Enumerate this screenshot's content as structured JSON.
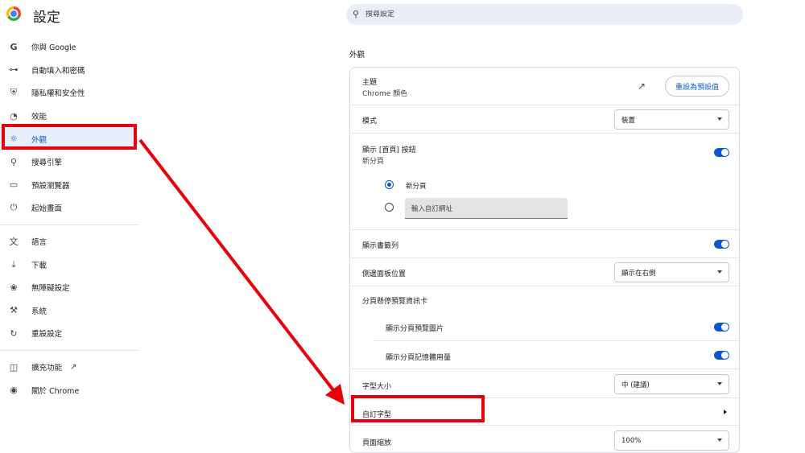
{
  "app": {
    "title": "設定"
  },
  "search": {
    "placeholder": "搜尋設定"
  },
  "sidebar": {
    "items": [
      {
        "label": "你與 Google",
        "icon": "google-icon"
      },
      {
        "label": "自動填入和密碼",
        "icon": "key-icon"
      },
      {
        "label": "隱私權和安全性",
        "icon": "shield-icon"
      },
      {
        "label": "效能",
        "icon": "speedometer-icon"
      },
      {
        "label": "外觀",
        "icon": "palette-icon",
        "active": true
      },
      {
        "label": "搜尋引擎",
        "icon": "search-icon"
      },
      {
        "label": "預設瀏覽器",
        "icon": "browser-window-icon"
      },
      {
        "label": "起始畫面",
        "icon": "power-icon"
      },
      {
        "label": "語言",
        "icon": "translate-icon"
      },
      {
        "label": "下載",
        "icon": "download-icon"
      },
      {
        "label": "無障礙設定",
        "icon": "accessibility-icon"
      },
      {
        "label": "系統",
        "icon": "wrench-icon"
      },
      {
        "label": "重設設定",
        "icon": "reset-icon"
      },
      {
        "label": "擴充功能",
        "icon": "puzzle-icon"
      },
      {
        "label": "關於 Chrome",
        "icon": "chrome-icon"
      }
    ]
  },
  "appearance": {
    "section_title": "外觀",
    "theme": {
      "label": "主題",
      "value": "Chrome 顏色",
      "reset_label": "重設為預設值"
    },
    "mode": {
      "label": "模式",
      "value": "裝置"
    },
    "home_button": {
      "label": "顯示 [首頁] 按鈕",
      "sub": "新分頁",
      "enabled": true
    },
    "radio_new_tab": {
      "label": "新分頁",
      "selected": true
    },
    "radio_custom_url": {
      "placeholder": "輸入自訂網址",
      "selected": false
    },
    "bookmarks_bar": {
      "label": "顯示書籤列",
      "enabled": true
    },
    "side_panel": {
      "label": "側邊面板位置",
      "value": "顯示在右側"
    },
    "tab_hover": {
      "label": "分頁懸停預覽資訊卡"
    },
    "tab_preview_image": {
      "label": "顯示分頁預覽圖片",
      "enabled": true
    },
    "tab_memory": {
      "label": "顯示分頁記憶體用量",
      "enabled": true
    },
    "font_size": {
      "label": "字型大小",
      "value": "中 (建議)"
    },
    "custom_fonts": {
      "label": "自訂字型"
    },
    "page_zoom": {
      "label": "頁面縮放",
      "value": "100%"
    }
  },
  "colors": {
    "accent": "#0b57d0",
    "annotation": "#e8000b",
    "active_nav_bg": "#e8eefc"
  }
}
